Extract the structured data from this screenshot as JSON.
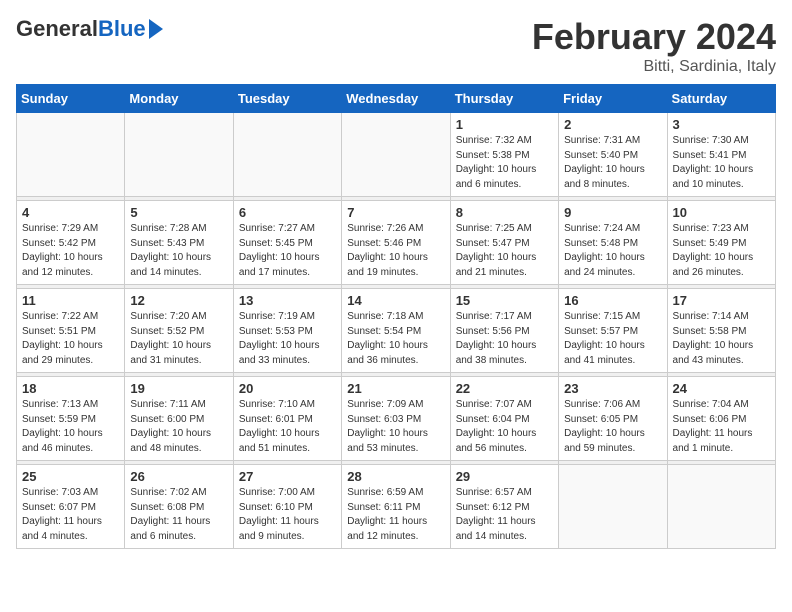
{
  "header": {
    "logo_general": "General",
    "logo_blue": "Blue",
    "month_title": "February 2024",
    "location": "Bitti, Sardinia, Italy"
  },
  "weekdays": [
    "Sunday",
    "Monday",
    "Tuesday",
    "Wednesday",
    "Thursday",
    "Friday",
    "Saturday"
  ],
  "weeks": [
    [
      {
        "day": "",
        "info": ""
      },
      {
        "day": "",
        "info": ""
      },
      {
        "day": "",
        "info": ""
      },
      {
        "day": "",
        "info": ""
      },
      {
        "day": "1",
        "info": "Sunrise: 7:32 AM\nSunset: 5:38 PM\nDaylight: 10 hours\nand 6 minutes."
      },
      {
        "day": "2",
        "info": "Sunrise: 7:31 AM\nSunset: 5:40 PM\nDaylight: 10 hours\nand 8 minutes."
      },
      {
        "day": "3",
        "info": "Sunrise: 7:30 AM\nSunset: 5:41 PM\nDaylight: 10 hours\nand 10 minutes."
      }
    ],
    [
      {
        "day": "4",
        "info": "Sunrise: 7:29 AM\nSunset: 5:42 PM\nDaylight: 10 hours\nand 12 minutes."
      },
      {
        "day": "5",
        "info": "Sunrise: 7:28 AM\nSunset: 5:43 PM\nDaylight: 10 hours\nand 14 minutes."
      },
      {
        "day": "6",
        "info": "Sunrise: 7:27 AM\nSunset: 5:45 PM\nDaylight: 10 hours\nand 17 minutes."
      },
      {
        "day": "7",
        "info": "Sunrise: 7:26 AM\nSunset: 5:46 PM\nDaylight: 10 hours\nand 19 minutes."
      },
      {
        "day": "8",
        "info": "Sunrise: 7:25 AM\nSunset: 5:47 PM\nDaylight: 10 hours\nand 21 minutes."
      },
      {
        "day": "9",
        "info": "Sunrise: 7:24 AM\nSunset: 5:48 PM\nDaylight: 10 hours\nand 24 minutes."
      },
      {
        "day": "10",
        "info": "Sunrise: 7:23 AM\nSunset: 5:49 PM\nDaylight: 10 hours\nand 26 minutes."
      }
    ],
    [
      {
        "day": "11",
        "info": "Sunrise: 7:22 AM\nSunset: 5:51 PM\nDaylight: 10 hours\nand 29 minutes."
      },
      {
        "day": "12",
        "info": "Sunrise: 7:20 AM\nSunset: 5:52 PM\nDaylight: 10 hours\nand 31 minutes."
      },
      {
        "day": "13",
        "info": "Sunrise: 7:19 AM\nSunset: 5:53 PM\nDaylight: 10 hours\nand 33 minutes."
      },
      {
        "day": "14",
        "info": "Sunrise: 7:18 AM\nSunset: 5:54 PM\nDaylight: 10 hours\nand 36 minutes."
      },
      {
        "day": "15",
        "info": "Sunrise: 7:17 AM\nSunset: 5:56 PM\nDaylight: 10 hours\nand 38 minutes."
      },
      {
        "day": "16",
        "info": "Sunrise: 7:15 AM\nSunset: 5:57 PM\nDaylight: 10 hours\nand 41 minutes."
      },
      {
        "day": "17",
        "info": "Sunrise: 7:14 AM\nSunset: 5:58 PM\nDaylight: 10 hours\nand 43 minutes."
      }
    ],
    [
      {
        "day": "18",
        "info": "Sunrise: 7:13 AM\nSunset: 5:59 PM\nDaylight: 10 hours\nand 46 minutes."
      },
      {
        "day": "19",
        "info": "Sunrise: 7:11 AM\nSunset: 6:00 PM\nDaylight: 10 hours\nand 48 minutes."
      },
      {
        "day": "20",
        "info": "Sunrise: 7:10 AM\nSunset: 6:01 PM\nDaylight: 10 hours\nand 51 minutes."
      },
      {
        "day": "21",
        "info": "Sunrise: 7:09 AM\nSunset: 6:03 PM\nDaylight: 10 hours\nand 53 minutes."
      },
      {
        "day": "22",
        "info": "Sunrise: 7:07 AM\nSunset: 6:04 PM\nDaylight: 10 hours\nand 56 minutes."
      },
      {
        "day": "23",
        "info": "Sunrise: 7:06 AM\nSunset: 6:05 PM\nDaylight: 10 hours\nand 59 minutes."
      },
      {
        "day": "24",
        "info": "Sunrise: 7:04 AM\nSunset: 6:06 PM\nDaylight: 11 hours\nand 1 minute."
      }
    ],
    [
      {
        "day": "25",
        "info": "Sunrise: 7:03 AM\nSunset: 6:07 PM\nDaylight: 11 hours\nand 4 minutes."
      },
      {
        "day": "26",
        "info": "Sunrise: 7:02 AM\nSunset: 6:08 PM\nDaylight: 11 hours\nand 6 minutes."
      },
      {
        "day": "27",
        "info": "Sunrise: 7:00 AM\nSunset: 6:10 PM\nDaylight: 11 hours\nand 9 minutes."
      },
      {
        "day": "28",
        "info": "Sunrise: 6:59 AM\nSunset: 6:11 PM\nDaylight: 11 hours\nand 12 minutes."
      },
      {
        "day": "29",
        "info": "Sunrise: 6:57 AM\nSunset: 6:12 PM\nDaylight: 11 hours\nand 14 minutes."
      },
      {
        "day": "",
        "info": ""
      },
      {
        "day": "",
        "info": ""
      }
    ]
  ]
}
